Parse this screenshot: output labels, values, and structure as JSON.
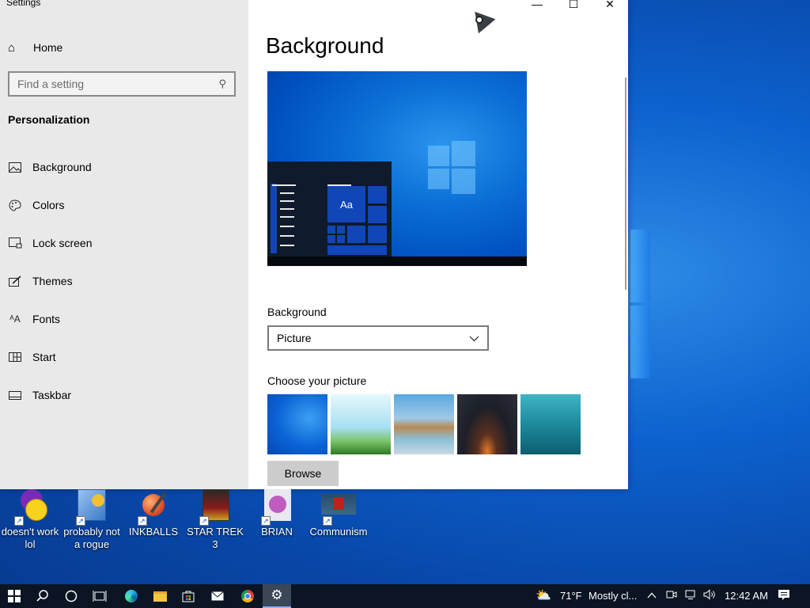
{
  "window": {
    "title": "Settings",
    "minimize_glyph": "—",
    "maximize_glyph": "☐",
    "close_glyph": "✕"
  },
  "sidebar": {
    "home_label": "Home",
    "search_placeholder": "Find a setting",
    "section_title": "Personalization",
    "items": [
      {
        "label": "Background",
        "icon": "picture-icon"
      },
      {
        "label": "Colors",
        "icon": "palette-icon"
      },
      {
        "label": "Lock screen",
        "icon": "lock-screen-icon"
      },
      {
        "label": "Themes",
        "icon": "brush-icon"
      },
      {
        "label": "Fonts",
        "icon": "font-icon"
      },
      {
        "label": "Start",
        "icon": "start-icon"
      },
      {
        "label": "Taskbar",
        "icon": "taskbar-icon"
      }
    ]
  },
  "main": {
    "page_title": "Background",
    "preview_sample_text": "Aa",
    "background_label": "Background",
    "background_value": "Picture",
    "choose_label": "Choose your picture",
    "browse_label": "Browse",
    "pictures": [
      {
        "name": "windows-blue",
        "colors": [
          "#0b63d6",
          "#2a8ff0"
        ]
      },
      {
        "name": "game-sky",
        "colors": [
          "#bfe6f5",
          "#2f8a2a"
        ]
      },
      {
        "name": "beach-rocks",
        "colors": [
          "#3d8fd0",
          "#caa36a"
        ]
      },
      {
        "name": "milky-way",
        "colors": [
          "#1a1d26",
          "#d6602a"
        ]
      },
      {
        "name": "underwater-swimmer",
        "colors": [
          "#1f8aa0",
          "#0c5566"
        ]
      }
    ]
  },
  "desktop_icons": [
    {
      "label": "doesn't work lol",
      "icon": "yahoo-messenger-icon",
      "color": "#7a2ab8"
    },
    {
      "label": "probably not a rogue",
      "icon": "security-shield-icon",
      "color": "#3b78c9"
    },
    {
      "label": "INKBALLS",
      "icon": "inkballs-icon",
      "color": "#e0502a"
    },
    {
      "label": "STAR TREK 3",
      "icon": "star-trek-icon",
      "color": "#8a1a1a"
    },
    {
      "label": "BRIAN",
      "icon": "brian-bird-icon",
      "color": "#c05cc0"
    },
    {
      "label": "Communism",
      "icon": "communism-icon",
      "color": "#2a4a6a"
    }
  ],
  "taskbar": {
    "weather_temp": "71°F",
    "weather_text": "Mostly cl...",
    "time": "12:42 AM",
    "accent": "#0b1524"
  }
}
